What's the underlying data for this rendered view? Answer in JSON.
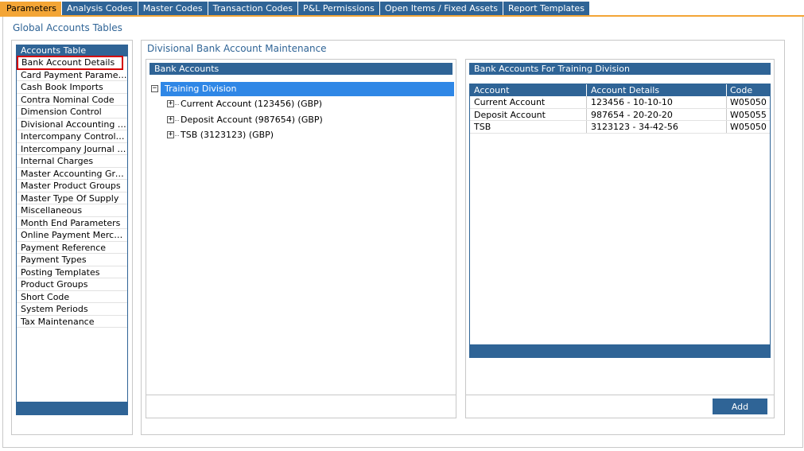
{
  "tabs": [
    {
      "label": "Parameters",
      "active": true
    },
    {
      "label": "Analysis Codes"
    },
    {
      "label": "Master Codes"
    },
    {
      "label": "Transaction Codes"
    },
    {
      "label": "P&L Permissions"
    },
    {
      "label": "Open Items / Fixed Assets"
    },
    {
      "label": "Report Templates"
    }
  ],
  "global_title": "Global Accounts Tables",
  "accounts_table": {
    "header": "Accounts Table",
    "selected_index": 0,
    "items": [
      "Bank Account Details",
      "Card Payment Parameters",
      "Cash Book Imports",
      "Contra Nominal Code",
      "Dimension Control",
      "Divisional Accounting Gro...",
      "Intercompany Control Co...",
      "Intercompany Journal Co...",
      "Internal Charges",
      "Master Accounting Groups",
      "Master Product Groups",
      "Master Type Of Supply",
      "Miscellaneous",
      "Month End Parameters",
      "Online Payment Merchants",
      "Payment Reference",
      "Payment Types",
      "Posting Templates",
      "Product Groups",
      "Short Code",
      "System Periods",
      "Tax Maintenance"
    ]
  },
  "main": {
    "title": "Divisional Bank Account Maintenance",
    "bank_accounts": {
      "header": "Bank Accounts",
      "root": {
        "toggle": "−",
        "label": "Training Division"
      },
      "children": [
        {
          "toggle": "+",
          "label": "Current Account (123456) (GBP)"
        },
        {
          "toggle": "+",
          "label": "Deposit Account (987654) (GBP)"
        },
        {
          "toggle": "+",
          "label": "TSB (3123123) (GBP)"
        }
      ]
    },
    "division_accounts": {
      "header": "Bank Accounts For Training Division",
      "columns": [
        "Account",
        "Account Details",
        "Code"
      ],
      "rows": [
        [
          "Current Account",
          "123456 - 10-10-10",
          "W05050"
        ],
        [
          "Deposit Account",
          "987654 - 20-20-20",
          "W05055"
        ],
        [
          "TSB",
          "3123123 - 34-42-56",
          "W05050"
        ]
      ],
      "add_label": "Add"
    }
  },
  "colors": {
    "brand_blue": "#2f6496",
    "active_tab": "#f3a536",
    "selection_blue": "#2f87e6",
    "selected_outline": "#d40000"
  }
}
